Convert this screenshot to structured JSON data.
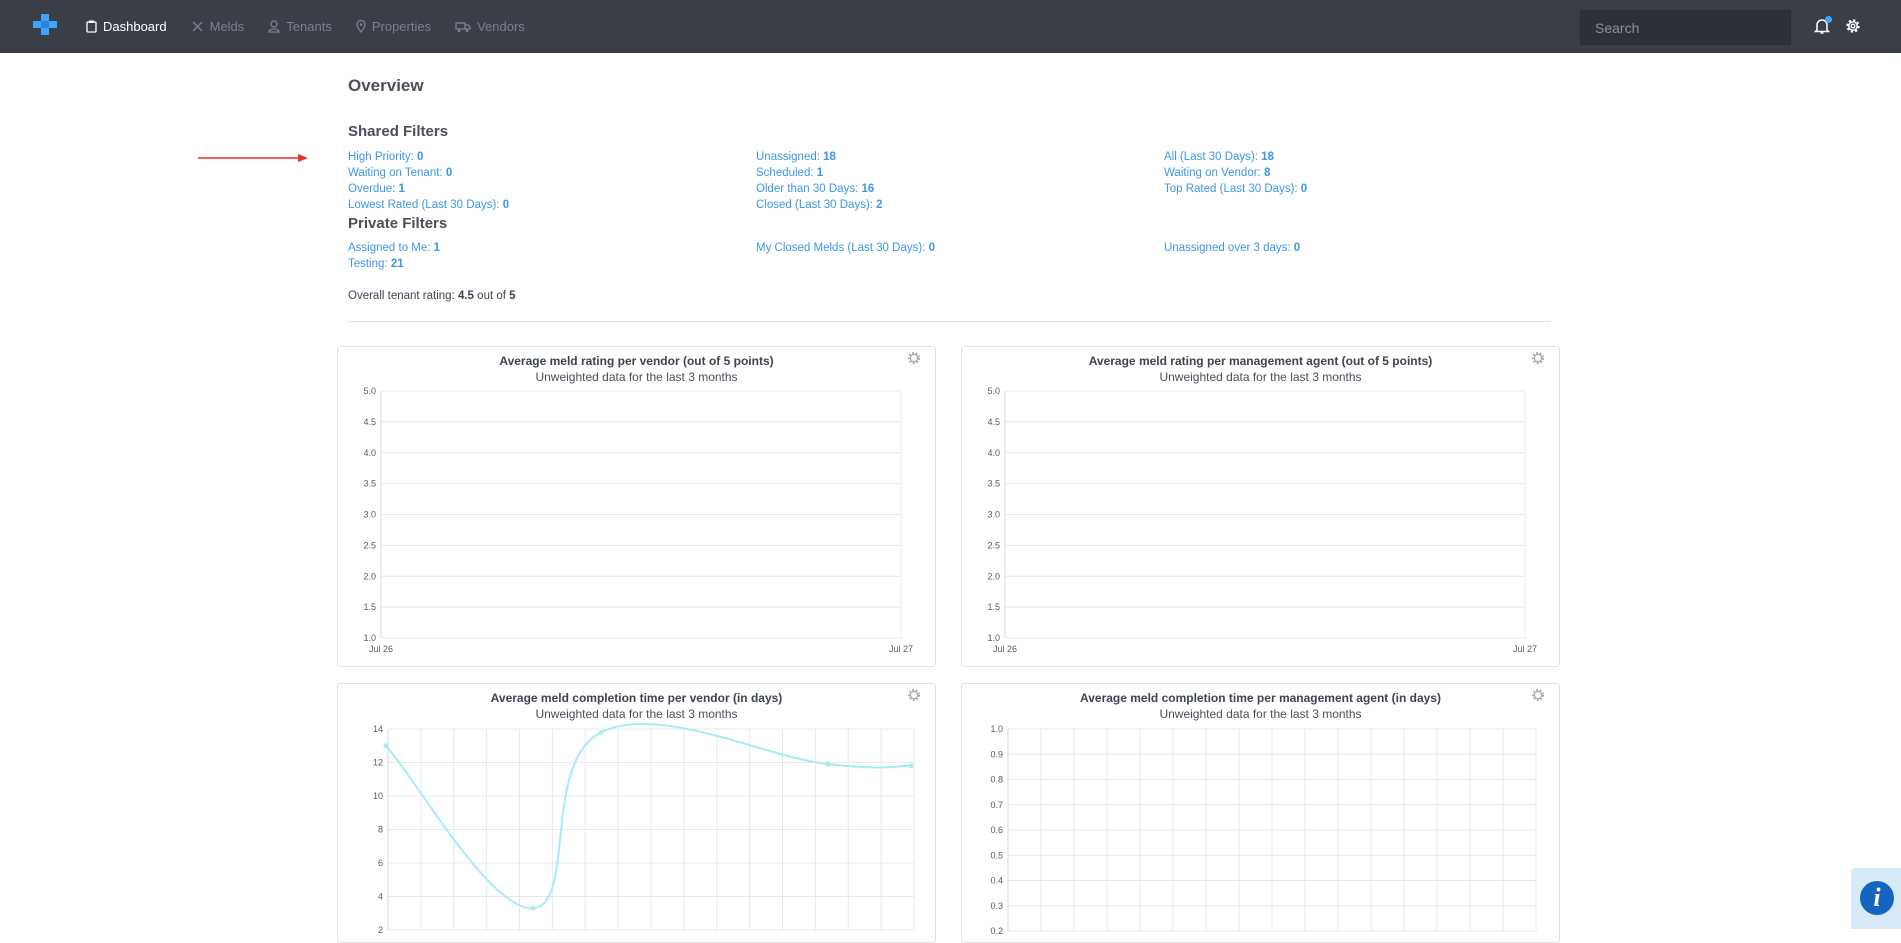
{
  "nav": {
    "items": [
      {
        "label": "Dashboard",
        "icon": "clipboard-icon",
        "active": true
      },
      {
        "label": "Melds",
        "icon": "tools-icon",
        "active": false
      },
      {
        "label": "Tenants",
        "icon": "person-icon",
        "active": false
      },
      {
        "label": "Properties",
        "icon": "map-pin-icon",
        "active": false
      },
      {
        "label": "Vendors",
        "icon": "truck-icon",
        "active": false
      }
    ],
    "search_placeholder": "Search"
  },
  "overview": {
    "title": "Overview",
    "shared_title": "Shared Filters",
    "private_title": "Private Filters",
    "shared": [
      {
        "label": "High Priority:",
        "count": "0"
      },
      {
        "label": "Waiting on Tenant:",
        "count": "0"
      },
      {
        "label": "Overdue:",
        "count": "1"
      },
      {
        "label": "Lowest Rated (Last 30 Days):",
        "count": "0"
      },
      {
        "label": "Unassigned:",
        "count": "18"
      },
      {
        "label": "Scheduled:",
        "count": "1"
      },
      {
        "label": "Older than 30 Days:",
        "count": "16"
      },
      {
        "label": "Closed (Last 30 Days):",
        "count": "2"
      },
      {
        "label": "All (Last 30 Days):",
        "count": "18"
      },
      {
        "label": "Waiting on Vendor:",
        "count": "8"
      },
      {
        "label": "Top Rated (Last 30 Days):",
        "count": "0"
      }
    ],
    "private": [
      {
        "label": "Assigned to Me:",
        "count": "1"
      },
      {
        "label": "Testing:",
        "count": "21"
      },
      {
        "label": "My Closed Melds (Last 30 Days):",
        "count": "0"
      },
      {
        "label": "Unassigned over 3 days:",
        "count": "0"
      }
    ],
    "rating": {
      "prefix": "Overall tenant rating:",
      "value": "4.5",
      "middle": "out of",
      "max": "5"
    }
  },
  "colors": {
    "topbar": "#3a3e46",
    "link": "#3d96e6",
    "line": "#a6ecf7",
    "arrow": "#e8312b",
    "logo": "#3ea5ff"
  },
  "chart_data": [
    {
      "type": "line",
      "title": "Average meld rating per vendor (out of 5 points)",
      "subtitle": "Unweighted data for the last 3 months",
      "x": [
        "Jul 26",
        "Jul 27"
      ],
      "y_ticks": [
        "5.0",
        "4.5",
        "4.0",
        "3.5",
        "3.0",
        "2.5",
        "2.0",
        "1.5",
        "1.0"
      ],
      "ylim": [
        1.0,
        5.0
      ],
      "series": []
    },
    {
      "type": "line",
      "title": "Average meld rating per management agent (out of 5 points)",
      "subtitle": "Unweighted data for the last 3 months",
      "x": [
        "Jul 26",
        "Jul 27"
      ],
      "y_ticks": [
        "5.0",
        "4.5",
        "4.0",
        "3.5",
        "3.0",
        "2.5",
        "2.0",
        "1.5",
        "1.0"
      ],
      "ylim": [
        1.0,
        5.0
      ],
      "series": []
    },
    {
      "type": "line",
      "title": "Average meld completion time per vendor (in days)",
      "subtitle": "Unweighted data for the last 3 months",
      "y_ticks": [
        "14",
        "12",
        "10",
        "8",
        "6",
        "4",
        "2"
      ],
      "ylim": [
        2,
        14
      ],
      "series": [
        {
          "values": [
            13.0,
            3.3,
            13.8,
            11.9,
            11.8
          ]
        }
      ]
    },
    {
      "type": "line",
      "title": "Average meld completion time per management agent (in days)",
      "subtitle": "Unweighted data for the last 3 months",
      "y_ticks": [
        "1.0",
        "0.9",
        "0.8",
        "0.7",
        "0.6",
        "0.5",
        "0.4",
        "0.3",
        "0.2"
      ],
      "ylim": [
        0.2,
        1.0
      ],
      "series": []
    }
  ]
}
